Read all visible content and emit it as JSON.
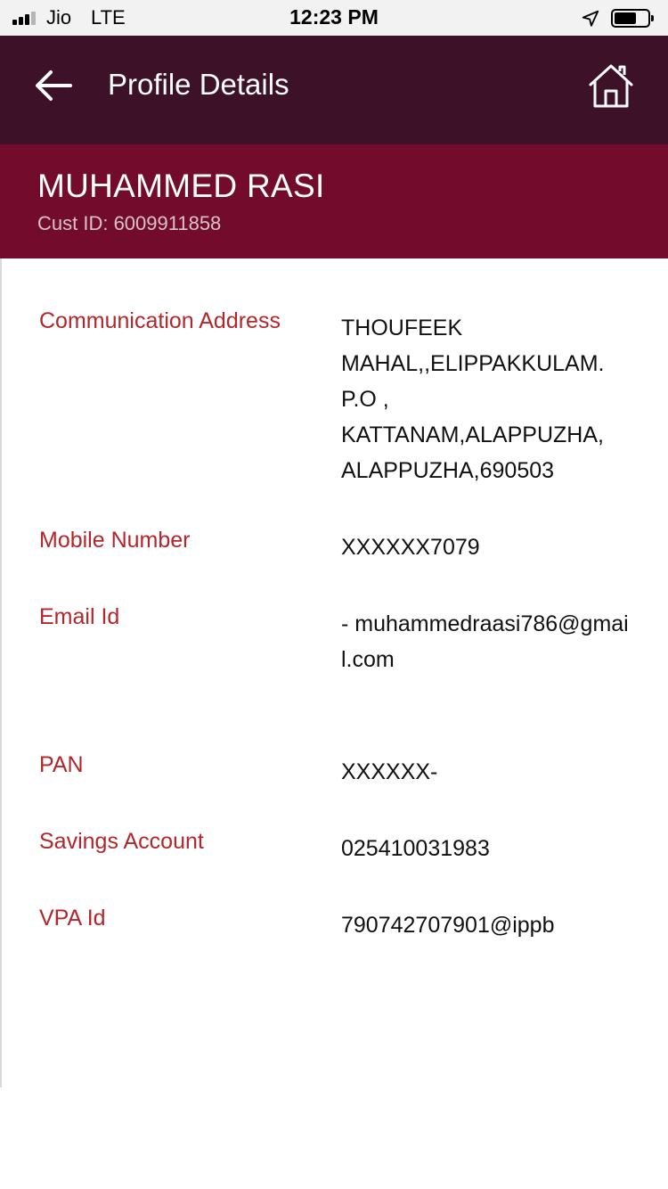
{
  "status_bar": {
    "carrier": "Jio",
    "network": "LTE",
    "time": "12:23 PM",
    "signal_bars_filled": 3,
    "signal_bars_total": 4,
    "battery_level": 0.6,
    "icons": [
      "signal-icon",
      "location-arrow-icon",
      "battery-icon"
    ]
  },
  "header": {
    "title": "Profile Details",
    "back_icon": "back-arrow-icon",
    "home_icon": "home-icon"
  },
  "profile": {
    "name": "MUHAMMED RASI",
    "cust_id": "Cust ID: 6009911858"
  },
  "details": [
    {
      "label": "Communication Address",
      "value": "THOUFEEK MAHAL,,ELIPPAKKULAM. P.O , KATTANAM,ALAPPUZHA, ALAPPUZHA,690503"
    },
    {
      "label": "Mobile Number",
      "value": "XXXXXX7079"
    },
    {
      "label": "Email Id",
      "value": "- muhammedraasi786@gmail.com"
    },
    {
      "label": "PAN",
      "value": "XXXXXX-"
    },
    {
      "label": "Savings Account",
      "value": "025410031983"
    },
    {
      "label": "VPA Id",
      "value": "790742707901@ippb"
    }
  ],
  "colors": {
    "header_bg": "#3d1127",
    "banner_bg": "#730c2c",
    "label_color": "#b3262b",
    "value_color": "#111111"
  }
}
